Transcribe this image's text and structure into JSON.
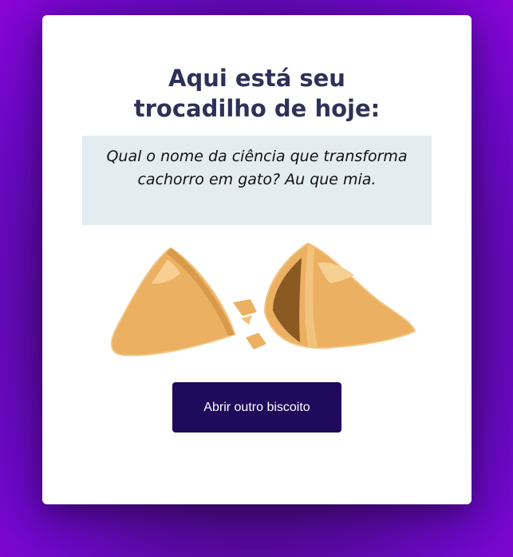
{
  "card": {
    "title_line1": "Aqui está seu",
    "title_line2": "trocadilho de hoje:",
    "pun_line1": "Qual o nome da ciência que transforma",
    "pun_line2": "cachorro em gato? Au que mia.",
    "button_label": "Abrir outro biscoito"
  },
  "colors": {
    "title": "#2e3158",
    "pun_background": "#e3ecf1",
    "button_background": "#1f0a5c",
    "cookie": "#ebb062",
    "cookie_highlight": "#f7cf92",
    "cookie_inside": "#8a5a22"
  },
  "icons": {
    "illustration": "broken-fortune-cookie-icon"
  }
}
